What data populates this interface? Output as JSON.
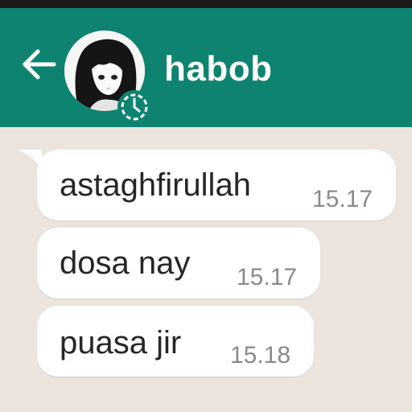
{
  "colors": {
    "header_bg": "#0e8470",
    "chat_bg": "#ece5dd",
    "bubble_bg": "#ffffff",
    "text": "#262626",
    "time_text": "#8a8a8a"
  },
  "header": {
    "back_icon": "arrow-left-icon",
    "avatar_icon": "profile-picture",
    "status_icon": "status-ring-icon",
    "contact_name": "habob"
  },
  "messages": [
    {
      "text": "astaghfirullah",
      "time": "15.17"
    },
    {
      "text": "dosa nay",
      "time": "15.17"
    },
    {
      "text": "puasa jir",
      "time": "15.18"
    }
  ]
}
